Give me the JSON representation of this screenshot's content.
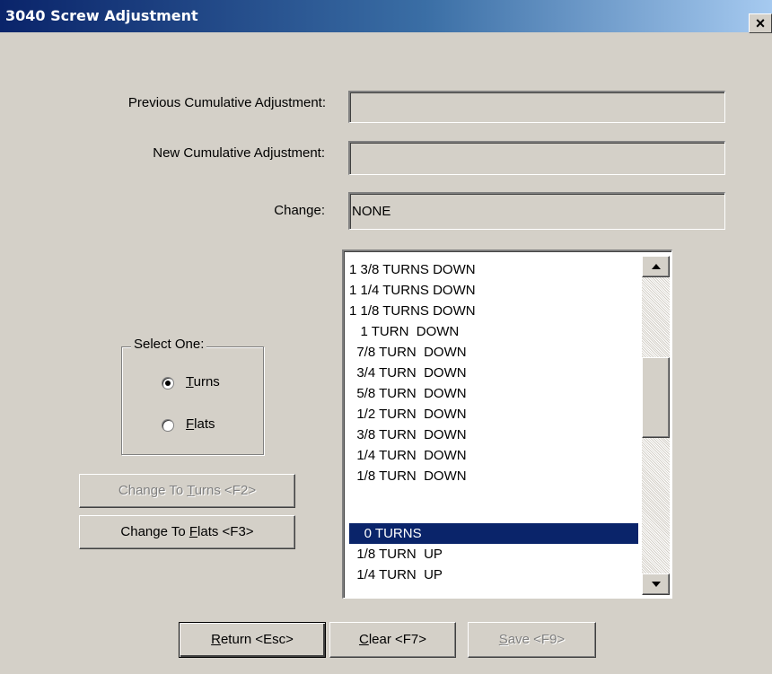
{
  "window": {
    "title": "3040 Screw Adjustment",
    "close_glyph": "×"
  },
  "fields": {
    "previous_label": "Previous Cumulative Adjustment:",
    "previous_value": "",
    "new_label": "New Cumulative Adjustment:",
    "new_value": "",
    "change_label": "Change:",
    "change_value": "NONE"
  },
  "select_group": {
    "legend": "Select One:",
    "turns": {
      "mnemonic": "T",
      "rest": "urns",
      "checked": true
    },
    "flats": {
      "mnemonic": "F",
      "rest": "lats",
      "checked": false
    }
  },
  "buttons": {
    "change_to_turns": {
      "before": "Change To ",
      "mnemonic": "T",
      "after": "urns <F2>",
      "enabled": false
    },
    "change_to_flats": {
      "before": "Change To ",
      "mnemonic": "F",
      "after": "lats <F3>",
      "enabled": true
    },
    "return": {
      "mnemonic": "R",
      "after": "eturn <Esc>",
      "enabled": true
    },
    "clear": {
      "mnemonic": "C",
      "after": "lear <F7>",
      "enabled": true
    },
    "save": {
      "mnemonic": "S",
      "after": "ave <F9>",
      "enabled": false
    }
  },
  "adjustment_list": {
    "items": [
      "1 3/8 TURNS DOWN",
      "1 1/4 TURNS DOWN",
      "1 1/8 TURNS DOWN",
      "   1 TURN  DOWN",
      "  7/8 TURN  DOWN",
      "  3/4 TURN  DOWN",
      "  5/8 TURN  DOWN",
      "  1/2 TURN  DOWN",
      "  3/8 TURN  DOWN",
      "  1/4 TURN  DOWN",
      "  1/8 TURN  DOWN",
      "    0 TURNS",
      "  1/8 TURN  UP",
      "  1/4 TURN  UP"
    ],
    "selected_index": 11
  },
  "colors": {
    "titlebar_start": "#0a246a",
    "titlebar_end": "#a6caf0",
    "selection": "#0a246a",
    "face": "#d4d0c8"
  }
}
